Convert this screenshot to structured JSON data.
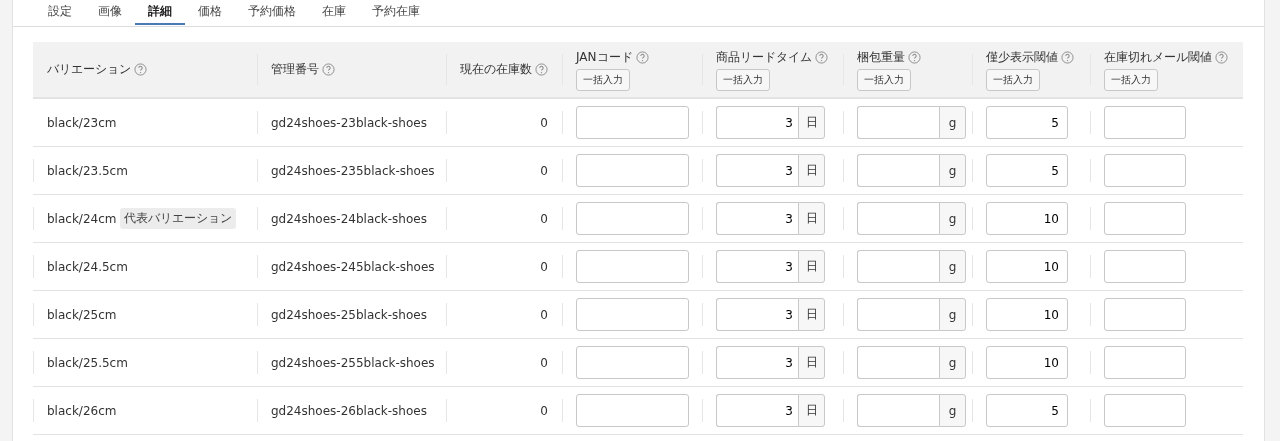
{
  "tabs": [
    {
      "label": "設定",
      "selected": false
    },
    {
      "label": "画像",
      "selected": false
    },
    {
      "label": "詳細",
      "selected": true
    },
    {
      "label": "価格",
      "selected": false
    },
    {
      "label": "予約価格",
      "selected": false
    },
    {
      "label": "在庫",
      "selected": false
    },
    {
      "label": "予約在庫",
      "selected": false
    }
  ],
  "table": {
    "columns": [
      {
        "label": "バリエーション"
      },
      {
        "label": "管理番号"
      },
      {
        "label": "現在の在庫数"
      },
      {
        "label": "JANコード",
        "bulk_button": "一括入力"
      },
      {
        "label": "商品リードタイム",
        "bulk_button": "一括入力"
      },
      {
        "label": "梱包重量",
        "bulk_button": "一括入力"
      },
      {
        "label": "僅少表示閾値",
        "bulk_button": "一括入力"
      },
      {
        "label": "在庫切れメール閾値",
        "bulk_button": "一括入力"
      }
    ],
    "rows": [
      {
        "variation": "black/23cm",
        "code": "gd24shoes-23black-shoes",
        "stock": "0",
        "lead_time": "3",
        "lead_unit": "日",
        "weight_unit": "g",
        "threshold": "5"
      },
      {
        "variation": "black/23.5cm",
        "code": "gd24shoes-235black-shoes",
        "stock": "0",
        "lead_time": "3",
        "lead_unit": "日",
        "weight_unit": "g",
        "threshold": "5"
      },
      {
        "variation": "black/24cm",
        "badge": "代表バリエーション",
        "code": "gd24shoes-24black-shoes",
        "stock": "0",
        "lead_time": "3",
        "lead_unit": "日",
        "weight_unit": "g",
        "threshold": "10"
      },
      {
        "variation": "black/24.5cm",
        "code": "gd24shoes-245black-shoes",
        "stock": "0",
        "lead_time": "3",
        "lead_unit": "日",
        "weight_unit": "g",
        "threshold": "10"
      },
      {
        "variation": "black/25cm",
        "code": "gd24shoes-25black-shoes",
        "stock": "0",
        "lead_time": "3",
        "lead_unit": "日",
        "weight_unit": "g",
        "threshold": "10"
      },
      {
        "variation": "black/25.5cm",
        "code": "gd24shoes-255black-shoes",
        "stock": "0",
        "lead_time": "3",
        "lead_unit": "日",
        "weight_unit": "g",
        "threshold": "10"
      },
      {
        "variation": "black/26cm",
        "code": "gd24shoes-26black-shoes",
        "stock": "0",
        "lead_time": "3",
        "lead_unit": "日",
        "weight_unit": "g",
        "threshold": "5"
      }
    ]
  }
}
